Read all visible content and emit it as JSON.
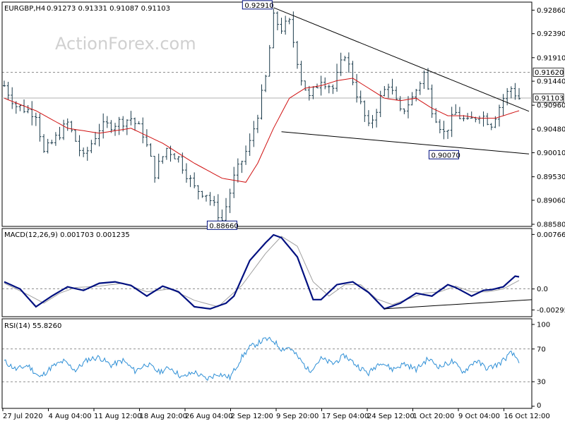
{
  "header": {
    "symbol": "EURGBP,H4",
    "ohlc": "0.91273 0.91331 0.91087 0.91103"
  },
  "watermark": "ActionForex.com",
  "colors": {
    "price_bars": "#1a3a4a",
    "moving_average": "#d01010",
    "macd_line": "#001080",
    "signal_line": "#a0a0a0",
    "rsi_line": "#2e8fd6",
    "trendlines": "#000000",
    "label_box_border": "#001080"
  },
  "chart_data": [
    {
      "type": "candlestick",
      "panel": "price",
      "ylim": [
        0.8858,
        0.9295
      ],
      "y_ticks": [
        "0.92860",
        "0.92390",
        "0.91910",
        "0.91440",
        "0.90960",
        "0.90480",
        "0.90010",
        "0.89530",
        "0.89060",
        "0.88580"
      ],
      "current_price": "0.91103",
      "reference_level": "0.91620",
      "annotations": [
        {
          "text": "0.92910",
          "bar": 68,
          "value": 0.9291
        },
        {
          "text": "0.88660",
          "bar": 55,
          "value": 0.8866
        },
        {
          "text": "0.90070",
          "bar": 111,
          "value": 0.9007
        }
      ],
      "trendlines": [
        {
          "from": [
            68,
            0.9291
          ],
          "to": [
            130,
            0.9088
          ]
        },
        {
          "from": [
            70,
            0.9043
          ],
          "to": [
            130,
            0.9
          ]
        }
      ],
      "anchors": [
        [
          0,
          0.9135
        ],
        [
          3,
          0.9095
        ],
        [
          8,
          0.908
        ],
        [
          10,
          0.9
        ],
        [
          14,
          0.904
        ],
        [
          16,
          0.906
        ],
        [
          20,
          0.899
        ],
        [
          24,
          0.905
        ],
        [
          28,
          0.906
        ],
        [
          32,
          0.907
        ],
        [
          35,
          0.904
        ],
        [
          38,
          0.896
        ],
        [
          41,
          0.901
        ],
        [
          44,
          0.899
        ],
        [
          48,
          0.893
        ],
        [
          51,
          0.892
        ],
        [
          55,
          0.8866
        ],
        [
          58,
          0.895
        ],
        [
          62,
          0.902
        ],
        [
          64,
          0.908
        ],
        [
          66,
          0.915
        ],
        [
          68,
          0.927
        ],
        [
          70,
          0.925
        ],
        [
          72,
          0.926
        ],
        [
          75,
          0.915
        ],
        [
          77,
          0.911
        ],
        [
          80,
          0.915
        ],
        [
          83,
          0.913
        ],
        [
          86,
          0.92
        ],
        [
          89,
          0.912
        ],
        [
          92,
          0.905
        ],
        [
          95,
          0.911
        ],
        [
          97,
          0.914
        ],
        [
          100,
          0.908
        ],
        [
          103,
          0.911
        ],
        [
          106,
          0.916
        ],
        [
          108,
          0.909
        ],
        [
          111,
          0.904
        ],
        [
          114,
          0.908
        ],
        [
          117,
          0.906
        ],
        [
          120,
          0.908
        ],
        [
          123,
          0.906
        ],
        [
          126,
          0.911
        ],
        [
          128,
          0.913
        ],
        [
          130,
          0.911
        ]
      ],
      "moving_average": [
        [
          0,
          0.911
        ],
        [
          8,
          0.9085
        ],
        [
          16,
          0.905
        ],
        [
          24,
          0.904
        ],
        [
          32,
          0.905
        ],
        [
          40,
          0.902
        ],
        [
          48,
          0.898
        ],
        [
          55,
          0.895
        ],
        [
          61,
          0.8942
        ],
        [
          64,
          0.898
        ],
        [
          68,
          0.905
        ],
        [
          72,
          0.911
        ],
        [
          76,
          0.913
        ],
        [
          80,
          0.9135
        ],
        [
          84,
          0.9145
        ],
        [
          88,
          0.915
        ],
        [
          92,
          0.913
        ],
        [
          96,
          0.911
        ],
        [
          100,
          0.9105
        ],
        [
          104,
          0.911
        ],
        [
          108,
          0.909
        ],
        [
          112,
          0.9075
        ],
        [
          116,
          0.9075
        ],
        [
          120,
          0.907
        ],
        [
          124,
          0.907
        ],
        [
          128,
          0.908
        ],
        [
          130,
          0.9085
        ]
      ]
    },
    {
      "type": "line",
      "panel": "macd",
      "title": "MACD(12,26,9) 0.001703 0.001235",
      "ylim": [
        -0.0036,
        0.0079
      ],
      "y_ticks": [
        "0.007663",
        "0.0",
        "-0.002952"
      ],
      "zero_label": "0.0",
      "series": [
        {
          "role": "macd",
          "values": [
            [
              0,
              0.001
            ],
            [
              4,
              0.0
            ],
            [
              8,
              -0.0025
            ],
            [
              12,
              -0.001
            ],
            [
              16,
              0.0003
            ],
            [
              20,
              -0.0002
            ],
            [
              24,
              0.0008
            ],
            [
              28,
              0.001
            ],
            [
              32,
              0.0005
            ],
            [
              36,
              -0.001
            ],
            [
              40,
              0.0004
            ],
            [
              44,
              -0.0004
            ],
            [
              48,
              -0.0025
            ],
            [
              52,
              -0.0028
            ],
            [
              56,
              -0.002
            ],
            [
              58,
              -0.001
            ],
            [
              62,
              0.004
            ],
            [
              66,
              0.0065
            ],
            [
              68,
              0.0076
            ],
            [
              70,
              0.0072
            ],
            [
              74,
              0.0045
            ],
            [
              78,
              -0.0015
            ],
            [
              80,
              -0.0015
            ],
            [
              84,
              0.0006
            ],
            [
              88,
              0.001
            ],
            [
              92,
              -0.0005
            ],
            [
              96,
              -0.0028
            ],
            [
              100,
              -0.002
            ],
            [
              104,
              -0.0006
            ],
            [
              108,
              -0.001
            ],
            [
              112,
              0.0006
            ],
            [
              114,
              0.0002
            ],
            [
              118,
              -0.001
            ],
            [
              121,
              -0.0002
            ],
            [
              123,
              -0.0001
            ],
            [
              126,
              0.0003
            ],
            [
              129,
              0.0018
            ],
            [
              130,
              0.0017
            ]
          ]
        },
        {
          "role": "signal",
          "values": [
            [
              0,
              0.0008
            ],
            [
              6,
              -0.0008
            ],
            [
              10,
              -0.002
            ],
            [
              14,
              -0.0006
            ],
            [
              18,
              0.0002
            ],
            [
              24,
              0.0004
            ],
            [
              30,
              0.0008
            ],
            [
              36,
              -0.0004
            ],
            [
              42,
              0.0
            ],
            [
              48,
              -0.0016
            ],
            [
              54,
              -0.0025
            ],
            [
              60,
              0.0005
            ],
            [
              66,
              0.005
            ],
            [
              70,
              0.0074
            ],
            [
              74,
              0.006
            ],
            [
              78,
              0.001
            ],
            [
              82,
              -0.001
            ],
            [
              86,
              0.0006
            ],
            [
              90,
              0.0006
            ],
            [
              94,
              -0.0014
            ],
            [
              98,
              -0.0022
            ],
            [
              102,
              -0.0014
            ],
            [
              106,
              -0.0006
            ],
            [
              110,
              -0.0004
            ],
            [
              114,
              0.0004
            ],
            [
              118,
              -0.0004
            ],
            [
              122,
              -0.0004
            ],
            [
              126,
              0.0
            ],
            [
              130,
              0.0012
            ]
          ]
        }
      ],
      "trendline": {
        "from": [
          96,
          -0.0028
        ],
        "to": [
          130,
          -0.0015
        ]
      }
    },
    {
      "type": "line",
      "panel": "rsi",
      "title": "RSI(14) 55.8260",
      "ylim": [
        0,
        100
      ],
      "y_ticks": [
        "100",
        "70",
        "30",
        "0"
      ],
      "levels": [
        70,
        30
      ],
      "values": [
        [
          0,
          55
        ],
        [
          3,
          45
        ],
        [
          6,
          50
        ],
        [
          9,
          35
        ],
        [
          12,
          48
        ],
        [
          15,
          55
        ],
        [
          18,
          44
        ],
        [
          21,
          57
        ],
        [
          24,
          60
        ],
        [
          27,
          50
        ],
        [
          30,
          56
        ],
        [
          33,
          43
        ],
        [
          36,
          52
        ],
        [
          39,
          42
        ],
        [
          42,
          47
        ],
        [
          45,
          35
        ],
        [
          48,
          42
        ],
        [
          51,
          33
        ],
        [
          54,
          40
        ],
        [
          57,
          35
        ],
        [
          60,
          60
        ],
        [
          62,
          72
        ],
        [
          64,
          77
        ],
        [
          66,
          82
        ],
        [
          68,
          80
        ],
        [
          70,
          70
        ],
        [
          72,
          72
        ],
        [
          75,
          55
        ],
        [
          77,
          43
        ],
        [
          80,
          58
        ],
        [
          83,
          52
        ],
        [
          86,
          62
        ],
        [
          89,
          50
        ],
        [
          92,
          40
        ],
        [
          95,
          55
        ],
        [
          98,
          45
        ],
        [
          101,
          52
        ],
        [
          104,
          45
        ],
        [
          107,
          58
        ],
        [
          110,
          48
        ],
        [
          113,
          55
        ],
        [
          116,
          42
        ],
        [
          119,
          56
        ],
        [
          122,
          46
        ],
        [
          125,
          52
        ],
        [
          128,
          65
        ],
        [
          130,
          56
        ]
      ]
    }
  ],
  "x_axis": {
    "labels": [
      "27 Jul 2020",
      "4 Aug 04:00",
      "11 Aug 12:00",
      "18 Aug 20:00",
      "26 Aug 04:00",
      "2 Sep 12:00",
      "9 Sep 20:00",
      "17 Sep 04:00",
      "24 Sep 12:00",
      "1 Oct 20:00",
      "9 Oct 04:00",
      "16 Oct 12:00"
    ]
  }
}
